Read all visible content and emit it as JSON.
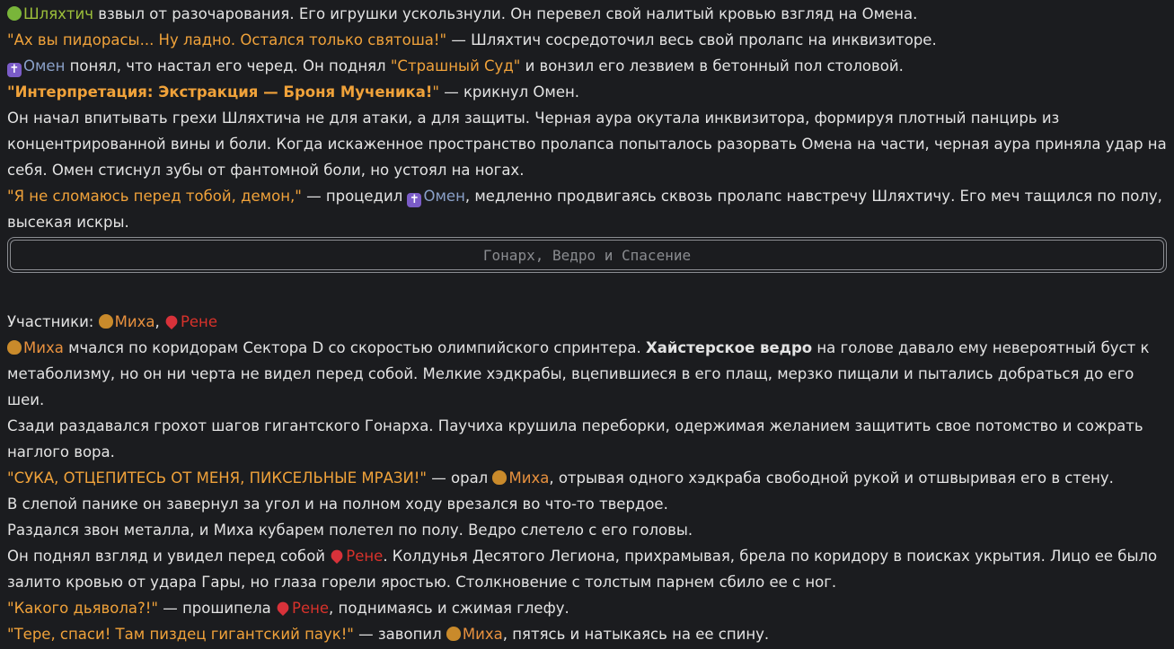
{
  "names": {
    "shl": "Шляхтич",
    "omen": "Омен",
    "mixa": "Миха",
    "rene": "Рене"
  },
  "p1": {
    "rest": " взвыл от разочарования. Его игрушки ускользнули. Он перевел свой налитый кровью взгляд на Омена."
  },
  "p2": {
    "quote": "\"Ах вы пидорасы... Ну ладно. Остался только святоша!\"",
    "rest": " — Шляхтич сосредоточил весь свой пролапс на инквизиторе."
  },
  "p3": {
    "a": " понял, что настал его черед. Он поднял ",
    "quote": "\"Страшный Суд\"",
    "b": " и вонзил его лезвием в бетонный пол столовой."
  },
  "p4": {
    "quote_open": "\"",
    "quote_bold": "Интерпретация: Экстракция — Броня Мученика!",
    "quote_close": "\"",
    "rest": " — крикнул Омен."
  },
  "p5": "Он начал впитывать грехи Шляхтича не для атаки, а для защиты. Черная аура окутала инквизитора, формируя плотный панцирь из концентрированной вины и боли. Когда искаженное пространство пролапса попыталось разорвать Омена на части, черная аура приняла удар на себя. Омен стиснул зубы от фантомной боли, но устоял на ногах.",
  "p6": {
    "quote": "\"Я не сломаюсь перед тобой, демон,\"",
    "a": " — процедил ",
    "b": ", медленно продвигаясь сквозь пролапс навстречу Шляхтичу. Его меч тащился по полу, высекая искры."
  },
  "divider_title": "Гонарх, Ведро и Спасение",
  "participants_label": "Участники: ",
  "comma": ", ",
  "q1": {
    "a": " мчался по коридорам Сектора D со скоростью олимпийского спринтера. ",
    "bold": "Хайстерское ведро",
    "b": " на голове давало ему невероятный буст к метаболизму, но он ни черта не видел перед собой. Мелкие хэдкрабы, вцепившиеся в его плащ, мерзко пищали и пытались добраться до его шеи."
  },
  "q2": "Сзади раздавался грохот шагов гигантского Гонарха. Паучиха крушила переборки, одержимая желанием защитить свое потомство и сожрать наглого вора.",
  "q3": {
    "quote": "\"СУКА, ОТЦЕПИТЕСЬ ОТ МЕНЯ, ПИКСЕЛЬНЫЕ МРАЗИ!\"",
    "a": " — орал ",
    "b": ", отрывая одного хэдкраба свободной рукой и отшвыривая его в стену."
  },
  "q4": "В слепой панике он завернул за угол и на полном ходу врезался во что-то твердое.",
  "q5": "Раздался звон металла, и Миха кубарем полетел по полу. Ведро слетело с его головы.",
  "q6": {
    "a": "Он поднял взгляд и увидел перед собой ",
    "b": ". Колдунья Десятого Легиона, прихрамывая, брела по коридору в поисках укрытия. Лицо ее было залито кровью от удара Гары, но глаза горели яростью. Столкновение с толстым парнем сбило ее с ног."
  },
  "q7": {
    "quote": "\"Какого дьявола?!\"",
    "a": " — прошипела ",
    "b": ", поднимаясь и сжимая глефу."
  },
  "q8": {
    "quote": "\"Тере, спаси! Там пиздец гигантский паук!\"",
    "a": " — завопил ",
    "b": ", пятясь и натыкаясь на ее спину."
  }
}
